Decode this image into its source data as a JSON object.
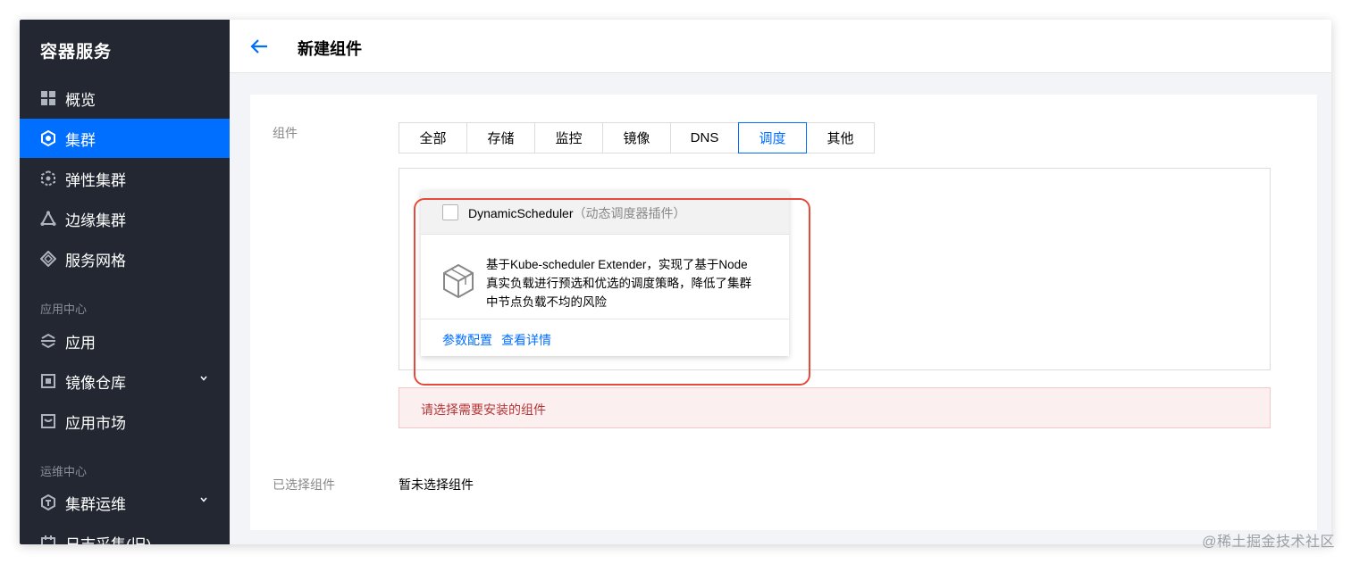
{
  "sidebar": {
    "brand": "容器服务",
    "items": [
      {
        "label": "概览",
        "icon": "dashboard-icon"
      },
      {
        "label": "集群",
        "icon": "cluster-icon"
      },
      {
        "label": "弹性集群",
        "icon": "elastic-cluster-icon"
      },
      {
        "label": "边缘集群",
        "icon": "edge-cluster-icon"
      },
      {
        "label": "服务网格",
        "icon": "service-mesh-icon"
      }
    ],
    "section_app": "应用中心",
    "app_items": [
      {
        "label": "应用",
        "icon": "application-icon"
      },
      {
        "label": "镜像仓库",
        "icon": "image-repo-icon"
      },
      {
        "label": "应用市场",
        "icon": "app-market-icon"
      }
    ],
    "section_ops": "运维中心",
    "ops_items": [
      {
        "label": "集群运维",
        "icon": "cluster-ops-icon"
      },
      {
        "label": "日志采集(旧)",
        "icon": "log-icon"
      }
    ],
    "active_index": 1
  },
  "header": {
    "title": "新建组件"
  },
  "form": {
    "component_label": "组件",
    "tabs": [
      "全部",
      "存储",
      "监控",
      "镜像",
      "DNS",
      "调度",
      "其他"
    ],
    "active_tab": 5,
    "card": {
      "name": "DynamicScheduler",
      "name_sub": "（动态调度器插件）",
      "desc_lines": [
        "基于Kube-scheduler Extender，实现了基于Node",
        "真实负载进行预选和优选的调度策略，降低了集群",
        "中节点负载不均的风险"
      ],
      "link_config": "参数配置",
      "link_detail": "查看详情"
    },
    "alert": "请选择需要安装的组件",
    "selected_label": "已选择组件",
    "selected_value": "暂未选择组件"
  },
  "watermark": "@稀土掘金技术社区",
  "colors": {
    "sidebar_bg": "#222731",
    "accent": "#006eff",
    "highlight": "#e54a3b",
    "alert_text": "#b43537"
  }
}
